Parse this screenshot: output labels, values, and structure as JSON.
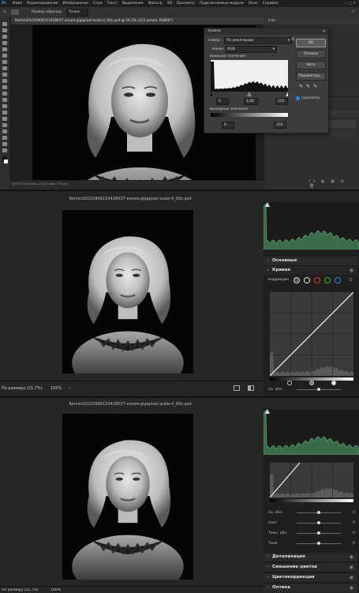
{
  "photoshop": {
    "menu": [
      "Файл",
      "Редактирование",
      "Изображение",
      "Слои",
      "Текст",
      "Выделение",
      "Фильтр",
      "3D",
      "Просмотр",
      "Подключаемые модули",
      "Окно",
      "Справка"
    ],
    "options_bar": {
      "sample_label": "Размер образца:",
      "sample_value": "Точка"
    },
    "doc_tab": "Remini20210906153428037-копия-gigapixel-scale-4_00x.psd @ 54,5% (123 копия, RGB/8*)",
    "status": "26,9%  1916 пикс x 3222 пикс (72 ppi)",
    "right_tab": "Сло",
    "levels": {
      "title": "Уровни",
      "preset_label": "Набор:",
      "preset_value": "По умолчанию",
      "channel_label": "Канал:",
      "channel_value": "RGB",
      "input_label": "Входные значения:",
      "input_values": [
        "0",
        "1,00",
        "255"
      ],
      "output_label": "Выходные значения:",
      "output_values": [
        "0",
        "255"
      ],
      "buttons": {
        "ok": "OK",
        "cancel": "Отмена",
        "auto": "Авто",
        "options": "Параметры..."
      },
      "preview_label": "Просмотр"
    }
  },
  "raw1": {
    "title": "Remini20210906153428037-копия-gigapixel-scale-4_00x.psd",
    "section_basic": "Основные",
    "section_curve": "Кривая",
    "correction_label": "Коррекция",
    "shadows_label": "Св. обл.",
    "zoom_label": "По размеру (21,7%)",
    "zoom_value": "100%"
  },
  "raw2": {
    "title": "Remini20210906153428037-копия-gigapixel-scale-4_00x.psd",
    "sliders": [
      {
        "label": "Св. обл.",
        "value": "0"
      },
      {
        "label": "Свет",
        "value": "0"
      },
      {
        "label": "Темн. обл.",
        "value": "0"
      },
      {
        "label": "Тени",
        "value": "0"
      }
    ],
    "sections": [
      "Детализация",
      "Смешение цветов",
      "Цветокоррекция",
      "Оптика"
    ],
    "zoom_label": "По размеру (21,7%)",
    "zoom_value": "100%"
  }
}
